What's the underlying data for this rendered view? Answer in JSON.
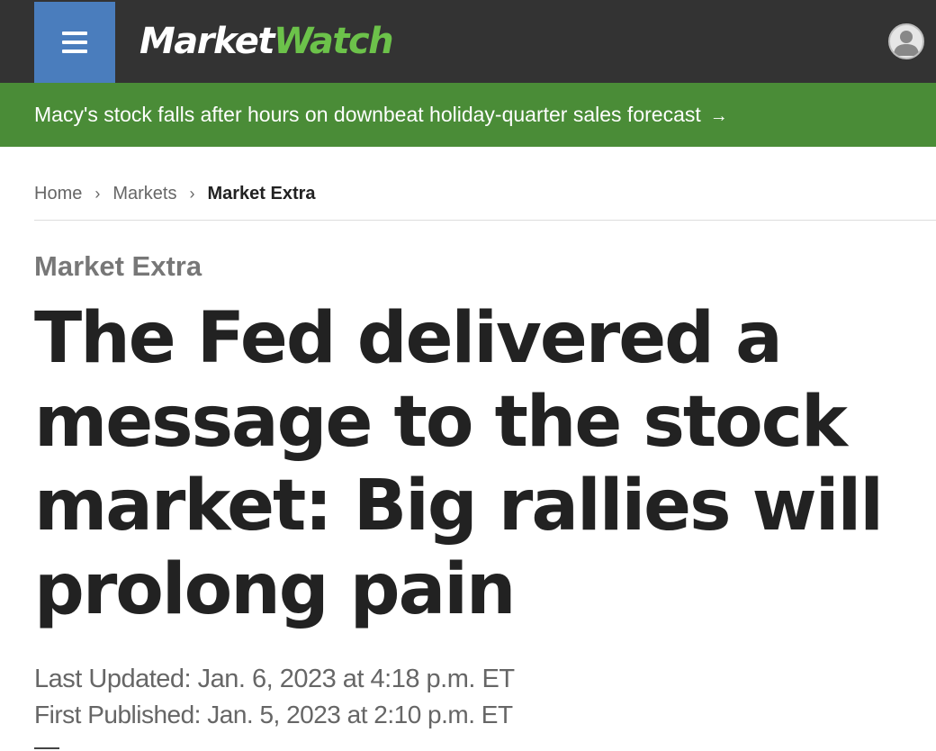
{
  "header": {
    "menu_icon": "hamburger-icon",
    "logo": {
      "part1": "Market",
      "part2": "Watch"
    },
    "avatar_icon": "user-avatar-icon",
    "colors": {
      "bar": "#333333",
      "menu": "#4a7dbd",
      "logo_accent": "#6cc24a"
    }
  },
  "ticker": {
    "text": "Macy's stock falls after hours on downbeat holiday-quarter sales forecast",
    "arrow": "→",
    "color": "#4a8c37"
  },
  "breadcrumb": {
    "items": [
      "Home",
      "Markets",
      "Market Extra"
    ],
    "separator": "›"
  },
  "article": {
    "section": "Market Extra",
    "headline": "The Fed delivered a message to the stock market: Big rallies will prolong pain",
    "last_updated": "Last Updated: Jan. 6, 2023 at 4:18 p.m. ET",
    "first_published": "First Published: Jan. 5, 2023 at 2:10 p.m. ET"
  }
}
